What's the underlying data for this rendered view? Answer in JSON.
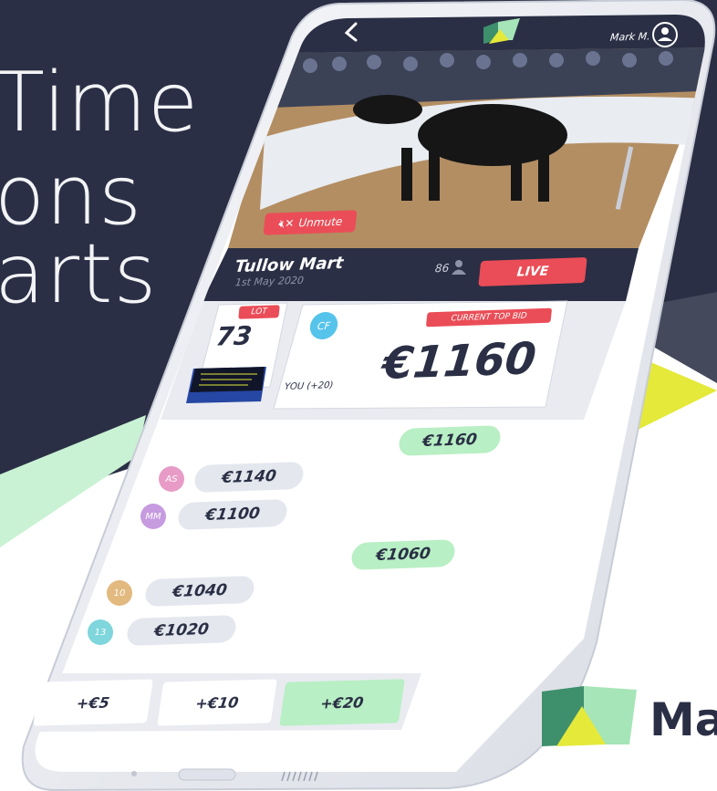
{
  "hero": {
    "line1": "Time",
    "line2": "ons",
    "line3": "arts"
  },
  "brand": {
    "word": "Ma",
    "logo": "M-logo-icon"
  },
  "colors": {
    "navy": "#2a2f45",
    "live_red": "#ea4d57",
    "mint": "#b8efc4",
    "yellow": "#e4e93a",
    "bid_grey": "#e4e7ee"
  },
  "topbar": {
    "back_icon": "chevron-left-icon",
    "logo_icon": "M-logo-icon",
    "user_name": "Mark M.",
    "user_icon": "user-avatar-icon"
  },
  "video": {
    "unmute_icon": "speaker-muted-icon",
    "unmute_label": "Unmute"
  },
  "mart": {
    "name": "Tullow Mart",
    "date": "1st May 2020",
    "viewers": "86",
    "viewers_icon": "person-icon",
    "live_label": "LIVE"
  },
  "lot": {
    "label": "LOT",
    "number": "73"
  },
  "top_bid": {
    "bidder": "CF",
    "label": "CURRENT TOP BID",
    "amount": "€1160",
    "you": "YOU (+20)"
  },
  "bids": [
    {
      "amount": "€1160",
      "side": "mine",
      "initials": ""
    },
    {
      "amount": "€1140",
      "side": "other",
      "initials": "AS",
      "color": "#e79bc6"
    },
    {
      "amount": "€1100",
      "side": "other",
      "initials": "MM",
      "color": "#c69be0"
    },
    {
      "amount": "€1060",
      "side": "mine",
      "initials": ""
    },
    {
      "amount": "€1040",
      "side": "other",
      "initials": "10",
      "color": "#e2b97f"
    },
    {
      "amount": "€1020",
      "side": "other",
      "initials": "13",
      "color": "#7fd6dc"
    }
  ],
  "increments": [
    {
      "label": "+€5",
      "selected": false
    },
    {
      "label": "+€10",
      "selected": false
    },
    {
      "label": "+€20",
      "selected": true
    }
  ]
}
